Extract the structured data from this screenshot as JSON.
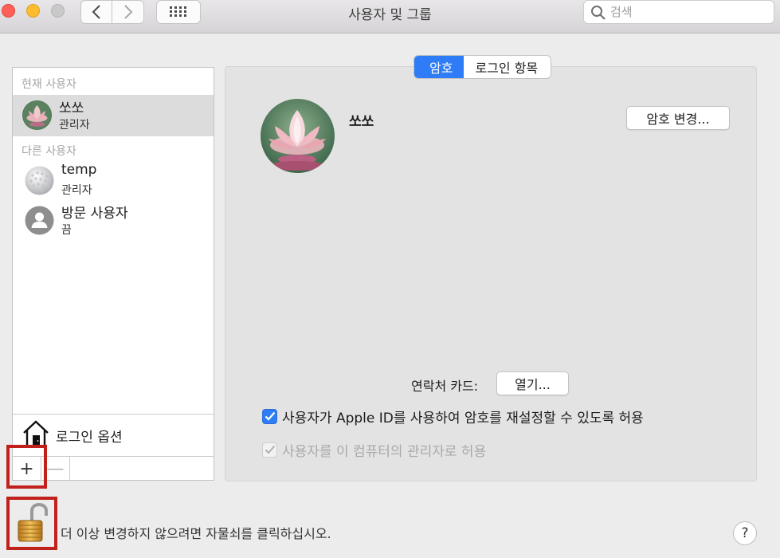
{
  "window": {
    "title": "사용자 및 그룹"
  },
  "search": {
    "placeholder": "검색",
    "value": ""
  },
  "sidebar": {
    "current_label": "현재 사용자",
    "other_label": "다른 사용자",
    "users": [
      {
        "name": "쏘쏘",
        "role": "관리자",
        "selected": true
      },
      {
        "name": "temp",
        "role": "관리자",
        "selected": false
      },
      {
        "name": "방문 사용자",
        "role": "끔",
        "selected": false
      }
    ],
    "login_options_label": "로그인 옵션",
    "add_label": "+",
    "remove_label": "—"
  },
  "tabs": [
    {
      "label": "암호",
      "active": true
    },
    {
      "label": "로그인 항목",
      "active": false
    }
  ],
  "main": {
    "user_name": "쏘쏘",
    "change_password_label": "암호 변경...",
    "contact_card_label": "연락처 카드:",
    "open_label": "열기...",
    "allow_apple_id_label": "사용자가 Apple ID를 사용하여 암호를 재설정할 수 있도록 허용",
    "allow_admin_label": "사용자를 이 컴퓨터의 관리자로 허용"
  },
  "footer": {
    "lock_text": "더 이상 변경하지 않으려면 자물쇠를 클릭하십시오.",
    "help_label": "?"
  },
  "colors": {
    "accent": "#2f7df6",
    "annotation": "#c0211b"
  }
}
